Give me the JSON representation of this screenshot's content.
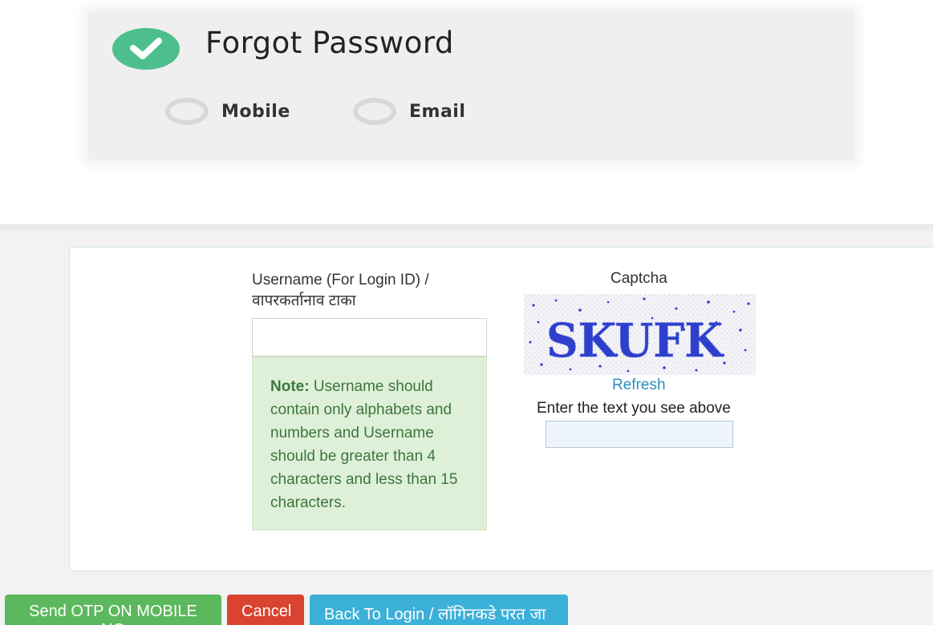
{
  "header": {
    "title": "Forgot Password",
    "options": [
      {
        "label": "Mobile"
      },
      {
        "label": "Email"
      }
    ]
  },
  "form": {
    "username_label_line1": "Username (For Login ID) /",
    "username_label_line2": "वापरकर्तानाव टाका",
    "username_value": "",
    "note_title": "Note:",
    "note_text": " Username should contain only alphabets and numbers and Username should be greater than 4 characters and less than 15 characters.",
    "captcha_label": "Captcha",
    "captcha_text": "SKUFK",
    "refresh_label": "Refresh",
    "captcha_hint": "Enter the text you see above",
    "captcha_value": ""
  },
  "buttons": {
    "send_otp": "Send OTP ON MOBILE NO",
    "cancel": "Cancel",
    "back_to_login": "Back To Login / लॉगिनकडे परत जा"
  },
  "colors": {
    "success_green": "#5cb85c",
    "danger_red": "#d9432f",
    "info_blue": "#3bb0d8",
    "note_bg": "#dff0d8",
    "check_badge": "#4cbf8c"
  }
}
